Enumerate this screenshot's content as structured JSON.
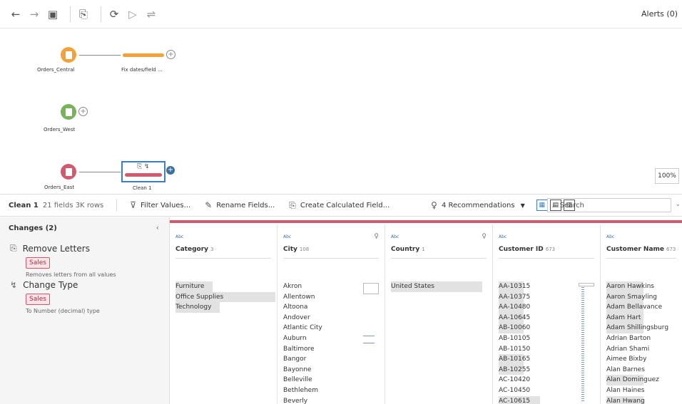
{
  "toolbar": {
    "alerts": "Alerts (0)"
  },
  "canvas": {
    "nodes": [
      {
        "label": "Orders_Central",
        "color": "#f3a23a"
      },
      {
        "label": "Orders_West",
        "color": "#78b25a"
      },
      {
        "label": "Orders_East",
        "color": "#d35a6e"
      }
    ],
    "steps": [
      {
        "label": "Fix dates/field ...",
        "color": "#f3a23a"
      },
      {
        "label": "Clean 1",
        "color": "#d35a6e"
      }
    ],
    "zoom": "100%"
  },
  "stepbar": {
    "step_name": "Clean 1",
    "meta": "21 fields  3K rows",
    "filter": "Filter Values...",
    "rename": "Rename Fields...",
    "calc": "Create Calculated Field...",
    "recommendations": "4 Recommendations",
    "search_placeholder": "Search"
  },
  "changes": {
    "header": "Changes (2)",
    "items": [
      {
        "title": "Remove Letters",
        "tag": "Sales",
        "desc": "Removes letters from all values"
      },
      {
        "title": "Change Type",
        "tag": "Sales",
        "desc": "To Number (decimal) type"
      }
    ]
  },
  "columns": [
    {
      "type": "Abc",
      "name": "Category",
      "count": "3",
      "values": [
        "Furniture",
        "Office Supplies",
        "Technology"
      ]
    },
    {
      "type": "Abc",
      "name": "City",
      "count": "108",
      "values": [
        "Akron",
        "Allentown",
        "Altoona",
        "Andover",
        "Atlantic City",
        "Auburn",
        "Baltimore",
        "Bangor",
        "Bayonne",
        "Belleville",
        "Bethlehem",
        "Beverly"
      ]
    },
    {
      "type": "Abc",
      "name": "Country",
      "count": "1",
      "values": [
        "United States"
      ]
    },
    {
      "type": "Abc",
      "name": "Customer ID",
      "count": "673",
      "values": [
        "AA-10315",
        "AA-10375",
        "AA-10480",
        "AA-10645",
        "AB-10060",
        "AB-10105",
        "AB-10150",
        "AB-10165",
        "AB-10255",
        "AC-10420",
        "AC-10450",
        "AC-10615"
      ]
    },
    {
      "type": "Abc",
      "name": "Customer Name",
      "count": "673",
      "values": [
        "Aaron Hawkins",
        "Aaron Smayling",
        "Adam Bellavance",
        "Adam Hart",
        "Adam Shillingsburg",
        "Adrian Barton",
        "Adrian Shami",
        "Aimee Bixby",
        "Alan Barnes",
        "Alan Dominguez",
        "Alan Haines",
        "Alan Hwang"
      ]
    }
  ]
}
